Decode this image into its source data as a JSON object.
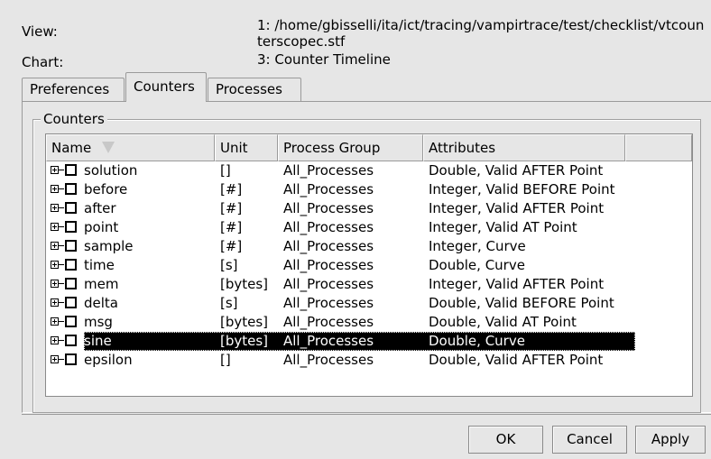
{
  "info": {
    "view_label": "View:",
    "view_value_line1": "1: /home/gbisselli/ita/ict/tracing/vampirtrace/test/checklist/vtcoun",
    "view_value_line2": "terscopec.stf",
    "chart_label": "Chart:",
    "chart_value": "3: Counter Timeline"
  },
  "tabs": [
    {
      "label": "Preferences",
      "active": false
    },
    {
      "label": "Counters",
      "active": true
    },
    {
      "label": "Processes",
      "active": false
    }
  ],
  "group_title": "Counters",
  "columns": [
    "Name",
    "Unit",
    "Process Group",
    "Attributes",
    ""
  ],
  "rows": [
    {
      "name": "solution",
      "unit": "[]",
      "group": "All_Processes",
      "attributes": "Double, Valid AFTER Point",
      "selected": false
    },
    {
      "name": "before",
      "unit": "[#]",
      "group": "All_Processes",
      "attributes": "Integer, Valid BEFORE Point",
      "selected": false
    },
    {
      "name": "after",
      "unit": "[#]",
      "group": "All_Processes",
      "attributes": "Integer, Valid AFTER Point",
      "selected": false
    },
    {
      "name": "point",
      "unit": "[#]",
      "group": "All_Processes",
      "attributes": "Integer, Valid AT Point",
      "selected": false
    },
    {
      "name": "sample",
      "unit": "[#]",
      "group": "All_Processes",
      "attributes": "Integer, Curve",
      "selected": false
    },
    {
      "name": "time",
      "unit": "[s]",
      "group": "All_Processes",
      "attributes": "Double, Curve",
      "selected": false
    },
    {
      "name": "mem",
      "unit": "[bytes]",
      "group": "All_Processes",
      "attributes": "Integer, Valid AFTER Point",
      "selected": false
    },
    {
      "name": "delta",
      "unit": "[s]",
      "group": "All_Processes",
      "attributes": "Double, Valid BEFORE Point",
      "selected": false
    },
    {
      "name": "msg",
      "unit": "[bytes]",
      "group": "All_Processes",
      "attributes": "Double, Valid AT Point",
      "selected": false
    },
    {
      "name": "sine",
      "unit": "[bytes]",
      "group": "All_Processes",
      "attributes": "Double, Curve",
      "selected": true
    },
    {
      "name": "epsilon",
      "unit": "[]",
      "group": "All_Processes",
      "attributes": "Double, Valid AFTER Point",
      "selected": false
    }
  ],
  "buttons": {
    "ok": "OK",
    "cancel": "Cancel",
    "apply": "Apply"
  }
}
